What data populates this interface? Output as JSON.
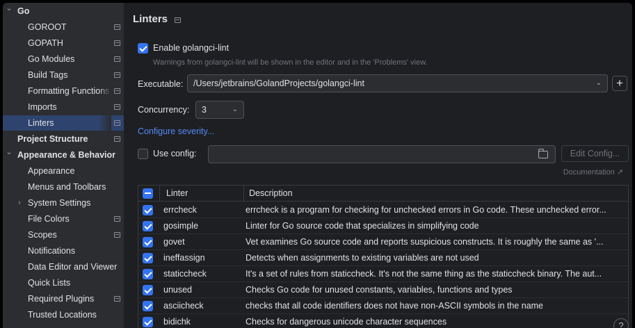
{
  "sidebar": {
    "items": [
      {
        "label": "Go",
        "bold": true,
        "chevron": "down",
        "level": 0,
        "proj": false,
        "selected": false
      },
      {
        "label": "GOROOT",
        "bold": false,
        "chevron": "",
        "level": 1,
        "proj": true,
        "selected": false
      },
      {
        "label": "GOPATH",
        "bold": false,
        "chevron": "",
        "level": 1,
        "proj": true,
        "selected": false
      },
      {
        "label": "Go Modules",
        "bold": false,
        "chevron": "",
        "level": 1,
        "proj": true,
        "selected": false
      },
      {
        "label": "Build Tags",
        "bold": false,
        "chevron": "",
        "level": 1,
        "proj": true,
        "selected": false
      },
      {
        "label": "Formatting Functions",
        "bold": false,
        "chevron": "",
        "level": 1,
        "proj": true,
        "selected": false
      },
      {
        "label": "Imports",
        "bold": false,
        "chevron": "",
        "level": 1,
        "proj": true,
        "selected": false
      },
      {
        "label": "Linters",
        "bold": false,
        "chevron": "",
        "level": 1,
        "proj": true,
        "selected": true
      },
      {
        "label": "Project Structure",
        "bold": true,
        "chevron": "",
        "level": 0,
        "proj": true,
        "selected": false
      },
      {
        "label": "Appearance & Behavior",
        "bold": true,
        "chevron": "down",
        "level": 0,
        "proj": false,
        "selected": false
      },
      {
        "label": "Appearance",
        "bold": false,
        "chevron": "",
        "level": 1,
        "proj": false,
        "selected": false
      },
      {
        "label": "Menus and Toolbars",
        "bold": false,
        "chevron": "",
        "level": 1,
        "proj": false,
        "selected": false
      },
      {
        "label": "System Settings",
        "bold": false,
        "chevron": "right",
        "level": 1,
        "proj": false,
        "selected": false
      },
      {
        "label": "File Colors",
        "bold": false,
        "chevron": "",
        "level": 1,
        "proj": true,
        "selected": false
      },
      {
        "label": "Scopes",
        "bold": false,
        "chevron": "",
        "level": 1,
        "proj": true,
        "selected": false
      },
      {
        "label": "Notifications",
        "bold": false,
        "chevron": "",
        "level": 1,
        "proj": false,
        "selected": false
      },
      {
        "label": "Data Editor and Viewer",
        "bold": false,
        "chevron": "",
        "level": 1,
        "proj": false,
        "selected": false
      },
      {
        "label": "Quick Lists",
        "bold": false,
        "chevron": "",
        "level": 1,
        "proj": false,
        "selected": false
      },
      {
        "label": "Required Plugins",
        "bold": false,
        "chevron": "",
        "level": 1,
        "proj": true,
        "selected": false
      },
      {
        "label": "Trusted Locations",
        "bold": false,
        "chevron": "",
        "level": 1,
        "proj": false,
        "selected": false
      }
    ]
  },
  "main": {
    "title": "Linters",
    "enable_label": "Enable golangci-lint",
    "enable_checked": true,
    "enable_hint": "Warnings from golangci-lint will be shown in the editor and in the 'Problems' view.",
    "executable_label": "Executable:",
    "executable_value": "/Users/jetbrains/GolandProjects/golangci-lint",
    "add_label": "+",
    "concurrency_label": "Concurrency:",
    "concurrency_value": "3",
    "configure_severity": "Configure severity...",
    "use_config_label": "Use config:",
    "use_config_checked": false,
    "use_config_value": "",
    "edit_config": "Edit Config...",
    "documentation": "Documentation ↗",
    "help": "?"
  },
  "table": {
    "columns": [
      "Linter",
      "Description"
    ],
    "rows": [
      {
        "enabled": true,
        "linter": "errcheck",
        "description": "errcheck is a program for checking for unchecked errors in Go code. These unchecked error..."
      },
      {
        "enabled": true,
        "linter": "gosimple",
        "description": "Linter for Go source code that specializes in simplifying code"
      },
      {
        "enabled": true,
        "linter": "govet",
        "description": "Vet examines Go source code and reports suspicious constructs. It is roughly the same as '..."
      },
      {
        "enabled": true,
        "linter": "ineffassign",
        "description": "Detects when assignments to existing variables are not used"
      },
      {
        "enabled": true,
        "linter": "staticcheck",
        "description": "It's a set of rules from staticcheck. It's not the same thing as the staticcheck binary. The aut..."
      },
      {
        "enabled": true,
        "linter": "unused",
        "description": "Checks Go code for unused constants, variables, functions and types"
      },
      {
        "enabled": true,
        "linter": "asciicheck",
        "description": "checks that all code identifiers does not have non-ASCII symbols in the name"
      },
      {
        "enabled": true,
        "linter": "bidichk",
        "description": "Checks for dangerous unicode character sequences"
      }
    ]
  },
  "colors": {
    "accent": "#3574f0",
    "link": "#548af7",
    "selection": "#2e436e"
  }
}
